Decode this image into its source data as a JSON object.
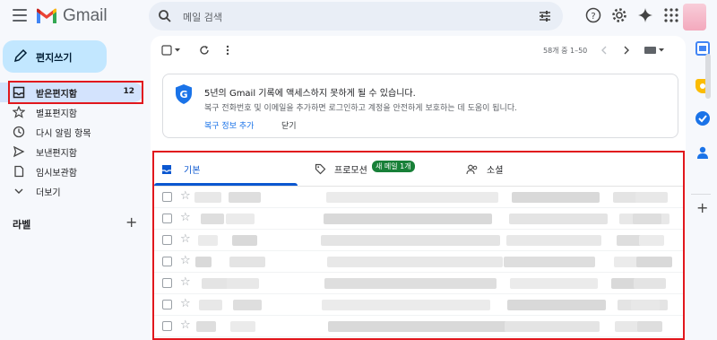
{
  "header": {
    "app_name": "Gmail",
    "search_placeholder": "메일 검색"
  },
  "sidebar": {
    "compose_label": "편지쓰기",
    "items": [
      {
        "label": "받은편지함",
        "count": "12"
      },
      {
        "label": "별표편지함"
      },
      {
        "label": "다시 알림 항목"
      },
      {
        "label": "보낸편지함"
      },
      {
        "label": "임시보관함"
      },
      {
        "label": "더보기"
      }
    ],
    "labels_title": "라벨",
    "labels_add": "+"
  },
  "toolbar": {
    "pager_text": "58개 중 1–50"
  },
  "banner": {
    "title": "5년의 Gmail 기록에 액세스하지 못하게 될 수 있습니다.",
    "description": "복구 전화번호 및 이메일을 추가하면 로그인하고 계정을 안전하게 보호하는 데 도움이 됩니다.",
    "action_link": "복구 정보 추가",
    "dismiss": "닫기"
  },
  "tabs": [
    {
      "label": "기본"
    },
    {
      "label": "프로모션",
      "badge": "새 메일 1개"
    },
    {
      "label": "소셜"
    }
  ],
  "colors": {
    "accent": "#0b57d0",
    "highlight_box": "#e1171d",
    "badge_green": "#188038",
    "compose_bg": "#c2e7ff",
    "active_nav_bg": "#d3e3fd"
  },
  "icons": {
    "rail": [
      "calendar-icon",
      "keep-icon",
      "tasks-icon",
      "contacts-icon"
    ]
  }
}
